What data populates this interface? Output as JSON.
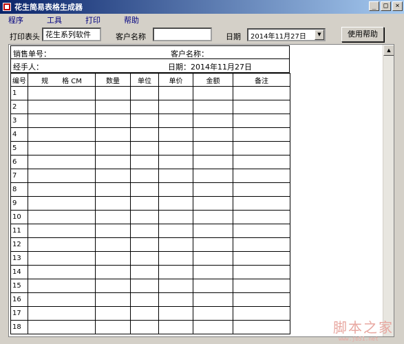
{
  "window": {
    "title": "花生简易表格生成器",
    "controls": [
      "_",
      "□",
      "×"
    ]
  },
  "menu": {
    "items": [
      "程序",
      "工具",
      "打印",
      "帮助"
    ]
  },
  "toolbar": {
    "print_header_label": "打印表头",
    "print_header_value": "花生系列软件",
    "customer_label": "客户名称",
    "customer_value": "",
    "date_label": "日期",
    "date_value": "2014年11月27日",
    "help_button": "使用帮助"
  },
  "sheet": {
    "sales_no_label": "销售单号：",
    "customer_label": "客户名称：",
    "handler_label": "经手人：",
    "date_text": "日期：2014年11月27日",
    "columns": [
      "编号",
      "规　　格 CM",
      "数量",
      "单位",
      "单价",
      "金额",
      "备注"
    ],
    "rows": [
      "1",
      "2",
      "3",
      "4",
      "5",
      "6",
      "7",
      "8",
      "9",
      "10",
      "11",
      "12",
      "13",
      "14",
      "15",
      "16",
      "17",
      "18"
    ]
  },
  "watermark": {
    "text": "脚本之家",
    "sub": "www.jb51.net"
  }
}
